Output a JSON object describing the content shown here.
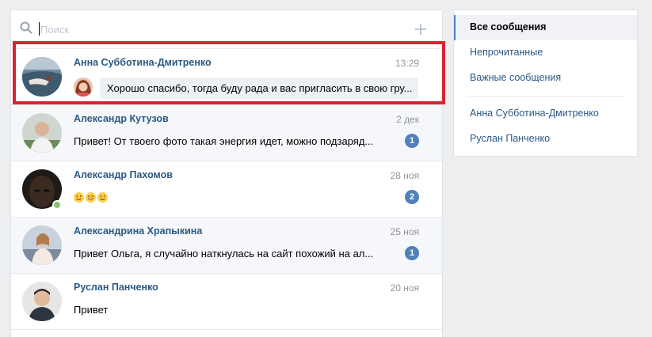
{
  "search": {
    "placeholder": "Поиск"
  },
  "dialogs": [
    {
      "name": "Анна Субботина-Дмитренко",
      "time": "13:29",
      "reply": "Хорошо спасибо, тогда буду рада и вас пригласить в свою гру..."
    },
    {
      "name": "Александр Кутузов",
      "time": "2 дек",
      "preview": "Привет! От твоего фото такая энергия идет, можно подзаряд...",
      "unread": "1"
    },
    {
      "name": "Александр Пахомов",
      "time": "28 ноя",
      "preview_emoji": [
        "smile",
        "grin",
        "smile"
      ],
      "unread": "2"
    },
    {
      "name": "Александрина Храпыкина",
      "time": "25 ноя",
      "preview": "Привет Ольга, я случайно наткнулась на сайт похожий на ал...",
      "unread": "1"
    },
    {
      "name": "Руслан Панченко",
      "time": "20 ноя",
      "preview": "Привет"
    }
  ],
  "menu": {
    "items": [
      "Все сообщения",
      "Непрочитанные",
      "Важные сообщения"
    ],
    "people": [
      "Анна Субботина-Дмитренко",
      "Руслан Панченко"
    ]
  },
  "colors": {
    "accent": "#5181b8",
    "link": "#2a5885",
    "highlight": "#d52533"
  }
}
